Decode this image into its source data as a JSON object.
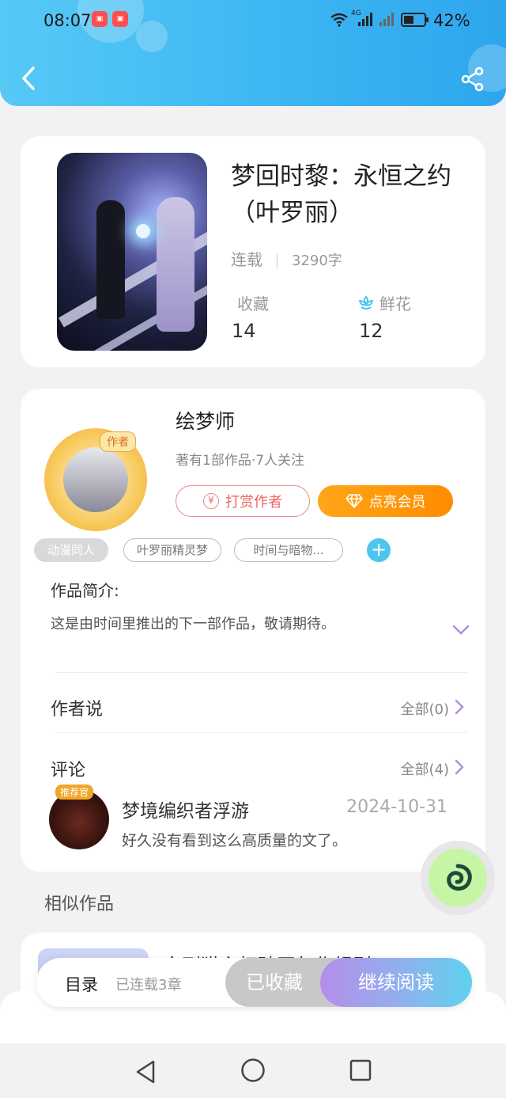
{
  "status_bar": {
    "time": "08:07",
    "battery": "42%",
    "network": "4G"
  },
  "header": {
    "back_icon": "chevron-left-icon",
    "share_icon": "share-icon"
  },
  "book": {
    "title": "梦回时黎：永恒之约（叶罗丽）",
    "status": "连载",
    "word_count": "3290字",
    "favorites_label": "收藏",
    "favorites_value": "14",
    "flowers_label": "鲜花",
    "flowers_value": "12"
  },
  "author": {
    "badge": "作者",
    "name": "绘梦师",
    "subtitle": "著有1部作品·7人关注",
    "tip_label": "打赏作者",
    "tip_icon_text": "¥",
    "vip_label": "点亮会员"
  },
  "tags": [
    "动漫同人",
    "叶罗丽精灵梦",
    "时间与暗物..."
  ],
  "intro": {
    "heading": "作品简介:",
    "text": "这是由时间里推出的下一部作品，敬请期待。"
  },
  "author_says": {
    "title": "作者说",
    "more": "全部(0)"
  },
  "comments": {
    "title": "评论",
    "more": "全部(4)",
    "items": [
      {
        "badge": "推荐官",
        "user": "梦境编织者浮游",
        "date": "2024-10-31",
        "text": "好久没有看到这么高质量的文了。"
      }
    ]
  },
  "similar": {
    "title": "相似作品",
    "first_book": "穿到猫主打破画年作规则"
  },
  "action_bar": {
    "toc": "目录",
    "serial": "已连载3章",
    "collected": "已收藏",
    "continue": "继续阅读"
  },
  "colors": {
    "header": "#3bb4f2",
    "vip": "#ff9a0d",
    "accent": "#4cc6ef",
    "tip": "#e66666"
  }
}
